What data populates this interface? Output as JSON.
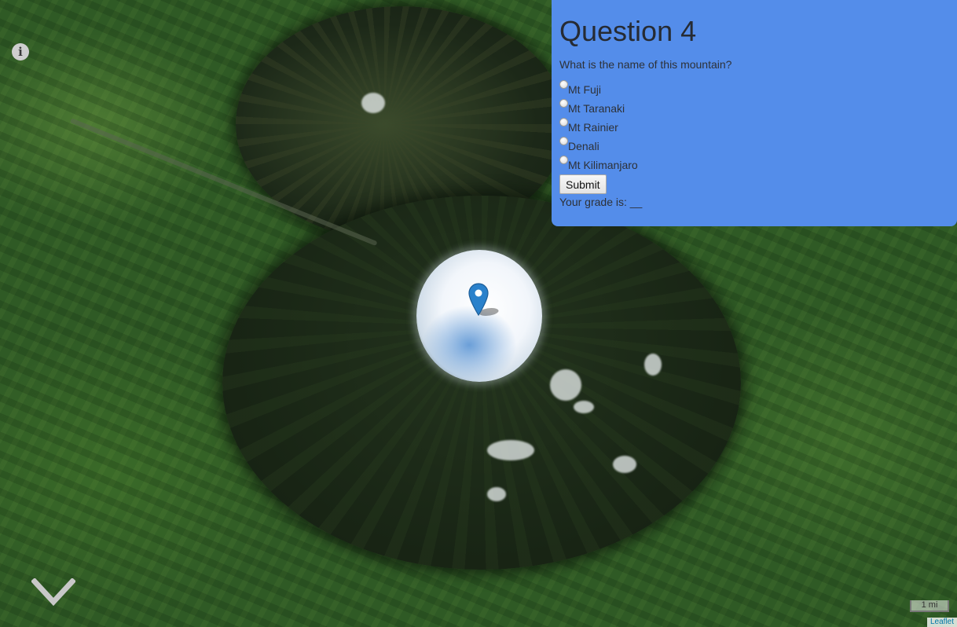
{
  "quiz": {
    "title": "Question 4",
    "question": "What is the name of this mountain?",
    "options": [
      {
        "label": "Mt Fuji",
        "selected": false
      },
      {
        "label": "Mt Taranaki",
        "selected": false
      },
      {
        "label": "Mt Rainier",
        "selected": false
      },
      {
        "label": "Denali",
        "selected": false
      },
      {
        "label": "Mt Kilimanjaro",
        "selected": false
      }
    ],
    "submit_label": "Submit",
    "grade_text": "Your grade is: __"
  },
  "map": {
    "info_icon": "info-icon",
    "marker_icon": "map-marker-icon",
    "scroll_icon": "chevron-down-icon",
    "scale_label": "1 mi",
    "attribution": "Leaflet"
  },
  "colors": {
    "panel_bg": "#548dea",
    "marker": "#2a81cb"
  }
}
